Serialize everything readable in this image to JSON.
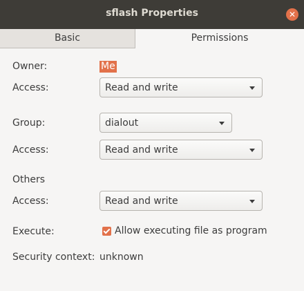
{
  "window": {
    "title": "sflash Properties",
    "close_icon": "close-icon"
  },
  "tabs": [
    {
      "label": "Basic"
    },
    {
      "label": "Permissions",
      "active": true
    }
  ],
  "owner": {
    "label": "Owner:",
    "value": "Me",
    "access_label": "Access:",
    "access_value": "Read and write"
  },
  "group": {
    "label": "Group:",
    "value": "dialout",
    "access_label": "Access:",
    "access_value": "Read and write"
  },
  "others": {
    "label": "Others",
    "access_label": "Access:",
    "access_value": "Read and write"
  },
  "execute": {
    "label": "Execute:",
    "checkbox_label": "Allow executing file as program",
    "checked": true
  },
  "security": {
    "label": "Security context:",
    "value": "unknown"
  },
  "colors": {
    "accent": "#e2714a",
    "titlebar": "#3e3c37"
  }
}
